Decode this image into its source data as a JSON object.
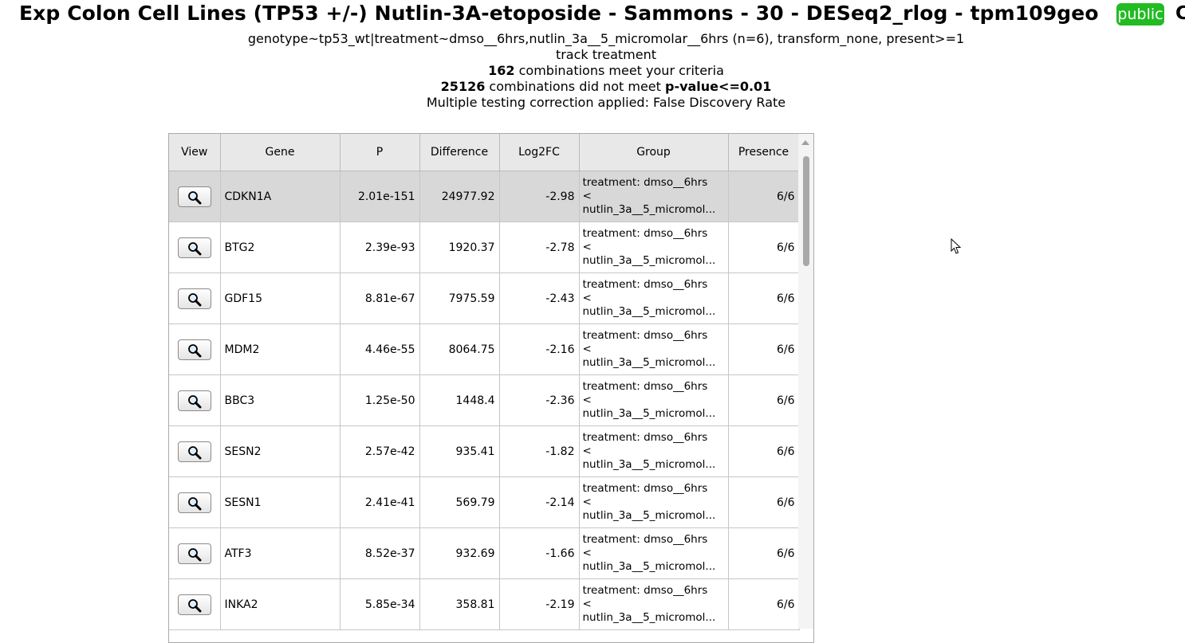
{
  "header": {
    "title": "Exp Colon Cell Lines (TP53 +/-) Nutlin-3A-etoposide - Sammons - 30 - DESeq2_rlog - tpm109geo",
    "badge": "public",
    "edge_glyph": "C"
  },
  "summary": {
    "criteria_line": "genotype~tp53_wt|treatment~dmso__6hrs,nutlin_3a__5_micromolar__6hrs (n=6), transform_none, present>=1",
    "track_line": "track treatment",
    "met_count": "162",
    "met_text": " combinations meet your criteria",
    "unmet_count": "25126",
    "unmet_text": " combinations did not meet ",
    "unmet_threshold": "p-value<=0.01",
    "correction_line": "Multiple testing correction applied: False Discovery Rate"
  },
  "table": {
    "columns": [
      "View",
      "Gene",
      "P",
      "Difference",
      "Log2FC",
      "Group",
      "Presence"
    ],
    "rows": [
      {
        "gene": "CDKN1A",
        "p": "2.01e-151",
        "difference": "24977.92",
        "log2fc": "-2.98",
        "group_l1": "treatment: dmso__6hrs",
        "group_l2": "<",
        "group_l3": "nutlin_3a__5_micromol...",
        "presence": "6/6",
        "selected": true
      },
      {
        "gene": "BTG2",
        "p": "2.39e-93",
        "difference": "1920.37",
        "log2fc": "-2.78",
        "group_l1": "treatment: dmso__6hrs",
        "group_l2": "<",
        "group_l3": "nutlin_3a__5_micromol...",
        "presence": "6/6"
      },
      {
        "gene": "GDF15",
        "p": "8.81e-67",
        "difference": "7975.59",
        "log2fc": "-2.43",
        "group_l1": "treatment: dmso__6hrs",
        "group_l2": "<",
        "group_l3": "nutlin_3a__5_micromol...",
        "presence": "6/6"
      },
      {
        "gene": "MDM2",
        "p": "4.46e-55",
        "difference": "8064.75",
        "log2fc": "-2.16",
        "group_l1": "treatment: dmso__6hrs",
        "group_l2": "<",
        "group_l3": "nutlin_3a__5_micromol...",
        "presence": "6/6"
      },
      {
        "gene": "BBC3",
        "p": "1.25e-50",
        "difference": "1448.4",
        "log2fc": "-2.36",
        "group_l1": "treatment: dmso__6hrs",
        "group_l2": "<",
        "group_l3": "nutlin_3a__5_micromol...",
        "presence": "6/6"
      },
      {
        "gene": "SESN2",
        "p": "2.57e-42",
        "difference": "935.41",
        "log2fc": "-1.82",
        "group_l1": "treatment: dmso__6hrs",
        "group_l2": "<",
        "group_l3": "nutlin_3a__5_micromol...",
        "presence": "6/6"
      },
      {
        "gene": "SESN1",
        "p": "2.41e-41",
        "difference": "569.79",
        "log2fc": "-2.14",
        "group_l1": "treatment: dmso__6hrs",
        "group_l2": "<",
        "group_l3": "nutlin_3a__5_micromol...",
        "presence": "6/6"
      },
      {
        "gene": "ATF3",
        "p": "8.52e-37",
        "difference": "932.69",
        "log2fc": "-1.66",
        "group_l1": "treatment: dmso__6hrs",
        "group_l2": "<",
        "group_l3": "nutlin_3a__5_micromol...",
        "presence": "6/6"
      },
      {
        "gene": "INKA2",
        "p": "5.85e-34",
        "difference": "358.81",
        "log2fc": "-2.19",
        "group_l1": "treatment: dmso__6hrs",
        "group_l2": "<",
        "group_l3": "nutlin_3a__5_micromol...",
        "presence": "6/6"
      }
    ]
  },
  "icons": {
    "view_button": "magnifier-icon",
    "pointer": "mouse-pointer-icon"
  },
  "colors": {
    "badge_bg": "#22bb22",
    "header_bg": "#e8e8e8",
    "selected_row_bg": "#d8d8d8"
  }
}
